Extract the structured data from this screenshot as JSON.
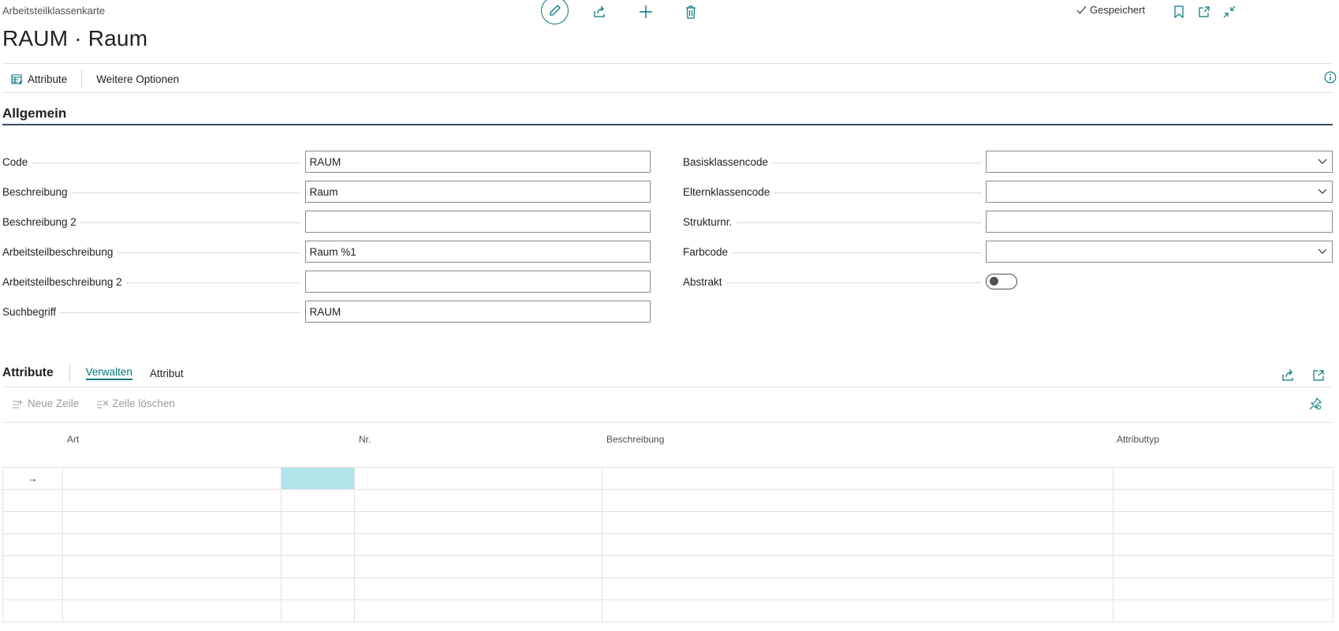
{
  "header": {
    "breadcrumb": "Arbeitsteilklassenkarte",
    "title": "RAUM · Raum",
    "status": "Gespeichert"
  },
  "actions": {
    "attribute_label": "Attribute",
    "more_options_label": "Weitere Optionen"
  },
  "section": {
    "title": "Allgemein"
  },
  "fields_left": [
    {
      "label": "Code",
      "value": "RAUM"
    },
    {
      "label": "Beschreibung",
      "value": "Raum"
    },
    {
      "label": "Beschreibung 2",
      "value": ""
    },
    {
      "label": "Arbeitsteilbeschreibung",
      "value": "Raum %1"
    },
    {
      "label": "Arbeitsteilbeschreibung 2",
      "value": ""
    },
    {
      "label": "Suchbegriff",
      "value": "RAUM"
    }
  ],
  "fields_right": [
    {
      "label": "Basisklassencode",
      "value": "",
      "type": "select"
    },
    {
      "label": "Elternklassencode",
      "value": "",
      "type": "select"
    },
    {
      "label": "Strukturnr.",
      "value": "",
      "type": "text"
    },
    {
      "label": "Farbcode",
      "value": "",
      "type": "select"
    },
    {
      "label": "Abstrakt",
      "value": "off",
      "type": "toggle"
    }
  ],
  "subpage": {
    "title": "Attribute",
    "tabs": [
      "Verwalten",
      "Attribut"
    ],
    "new_line_label": "Neue Zeile",
    "delete_line_label": "Zeile löschen",
    "columns": [
      "Art",
      "Nr.",
      "Beschreibung",
      "Attributtyp"
    ],
    "row_count": 7,
    "row_marker": "→"
  },
  "colors": {
    "accent": "#00777b",
    "selected_cell": "#b2e5ea"
  }
}
